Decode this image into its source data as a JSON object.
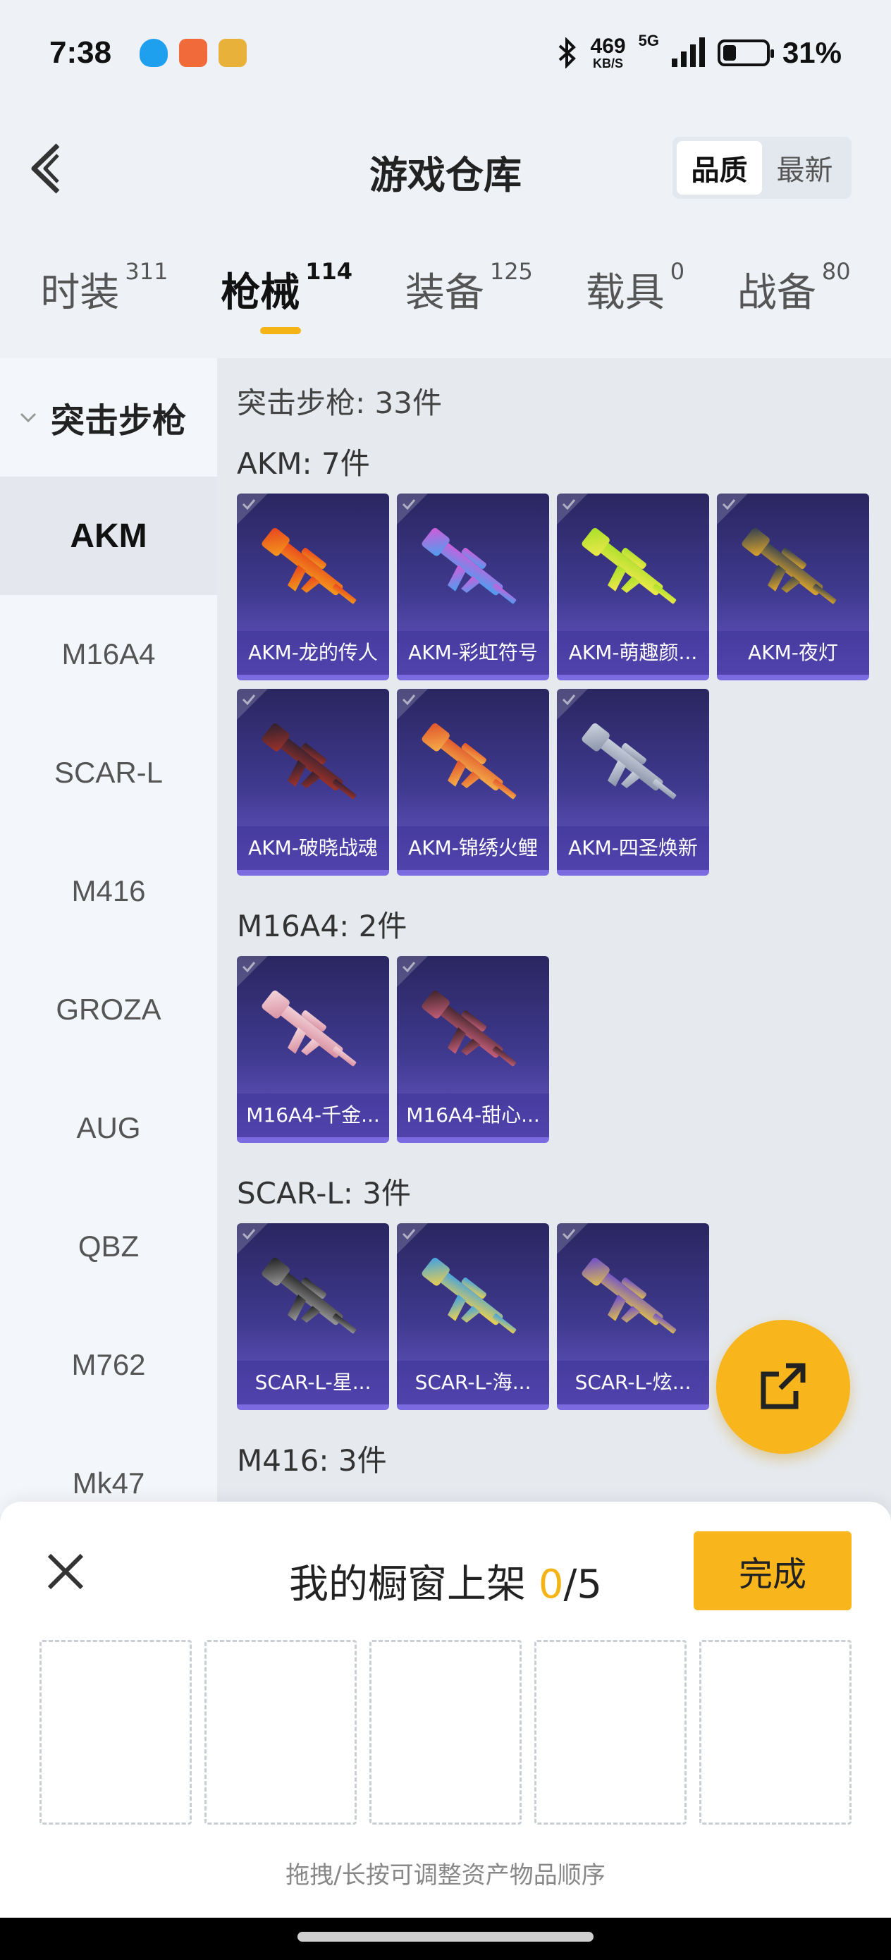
{
  "status_bar": {
    "time": "7:38",
    "net_speed": "469",
    "net_unit": "KB/S",
    "network": "5G",
    "battery_level": 0.31,
    "battery_pct": "31%"
  },
  "header": {
    "title": "游戏仓库",
    "sort_options": [
      "品质",
      "最新"
    ],
    "sort_selected": "品质"
  },
  "tabs": [
    {
      "label": "时装",
      "count": "311"
    },
    {
      "label": "枪械",
      "count": "114",
      "active": true
    },
    {
      "label": "装备",
      "count": "125"
    },
    {
      "label": "载具",
      "count": "0"
    },
    {
      "label": "战备",
      "count": "80"
    }
  ],
  "sidebar": {
    "category": "突击步枪",
    "items": [
      "AKM",
      "M16A4",
      "SCAR-L",
      "M416",
      "GROZA",
      "AUG",
      "QBZ",
      "M762",
      "Mk47"
    ],
    "active": "AKM"
  },
  "main": {
    "category_title": "突击步枪: 33件",
    "groups": [
      {
        "title": "AKM: 7件",
        "items": [
          {
            "name": "AKM-龙的传人",
            "colors": [
              "#e8431f",
              "#f39a1a"
            ]
          },
          {
            "name": "AKM-彩虹符号",
            "colors": [
              "#d45ad8",
              "#4aa0f0"
            ]
          },
          {
            "name": "AKM-萌趣颜...",
            "colors": [
              "#a6e02a",
              "#f0e84a"
            ]
          },
          {
            "name": "AKM-夜灯",
            "colors": [
              "#2e3e52",
              "#e2a82a"
            ]
          },
          {
            "name": "AKM-破晓战魂",
            "colors": [
              "#2b2030",
              "#a0322a"
            ]
          },
          {
            "name": "AKM-锦绣火鲤",
            "colors": [
              "#e0522a",
              "#f5b04a"
            ]
          },
          {
            "name": "AKM-四圣焕新",
            "colors": [
              "#cfd6e0",
              "#8892a8"
            ]
          }
        ]
      },
      {
        "title": "M16A4: 2件",
        "items": [
          {
            "name": "M16A4-千金...",
            "colors": [
              "#f3d6dc",
              "#d98fa0"
            ]
          },
          {
            "name": "M16A4-甜心...",
            "colors": [
              "#3a2228",
              "#c8607a"
            ]
          }
        ]
      },
      {
        "title": "SCAR-L: 3件",
        "items": [
          {
            "name": "SCAR-L-星...",
            "colors": [
              "#202020",
              "#9a9a9a"
            ]
          },
          {
            "name": "SCAR-L-海...",
            "colors": [
              "#3aa0e8",
              "#f0d04a"
            ]
          },
          {
            "name": "SCAR-L-炫...",
            "colors": [
              "#6a4ad0",
              "#e0c04a"
            ]
          }
        ]
      },
      {
        "title": "M416: 3件",
        "items": []
      }
    ]
  },
  "sheet": {
    "title_prefix": "我的橱窗上架 ",
    "current": "0",
    "total": "/5",
    "done_label": "完成",
    "slot_count": 5,
    "hint": "拖拽/长按可调整资产物品顺序"
  },
  "colors": {
    "accent": "#f8b51c",
    "item_bg_top": "#2a2660",
    "item_bg_bottom": "#6b58c8"
  }
}
